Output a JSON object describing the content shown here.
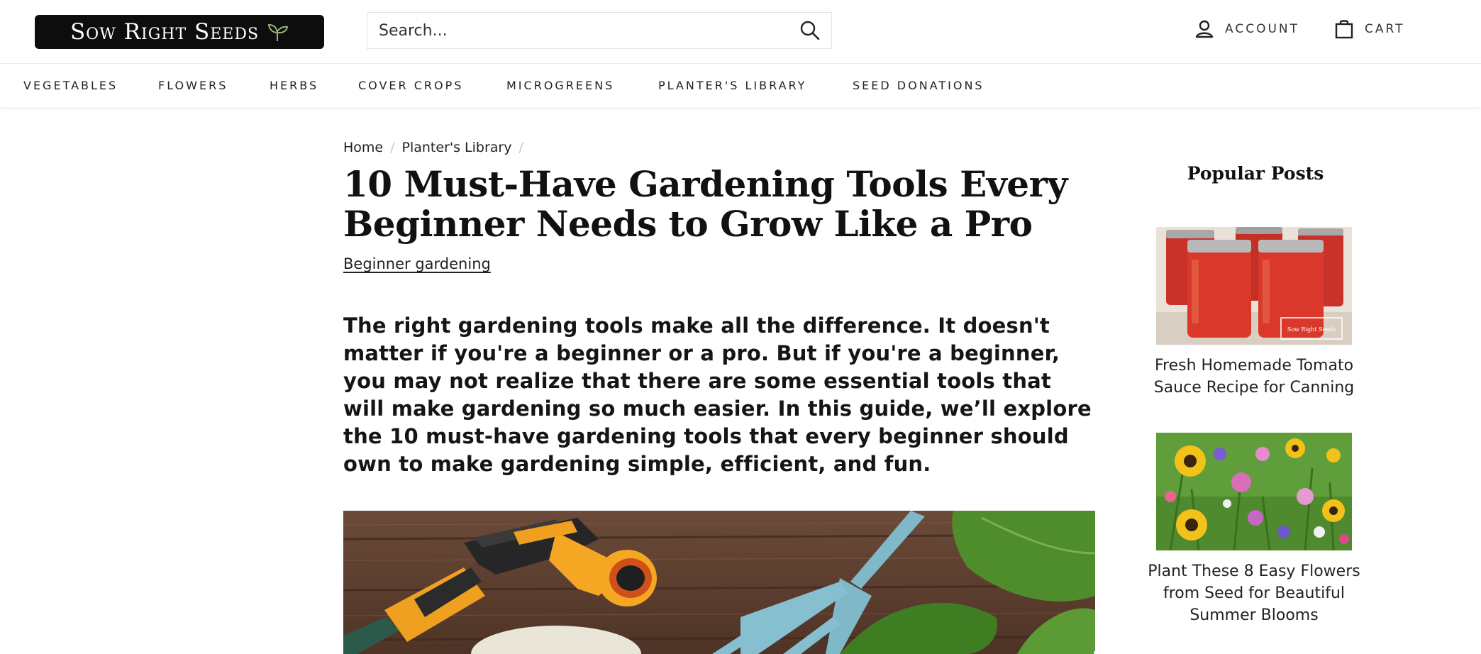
{
  "header": {
    "logo_text": "Sow Right Seeds",
    "search_placeholder": "Search...",
    "account_label": "ACCOUNT",
    "cart_label": "CART"
  },
  "nav": {
    "items": [
      "VEGETABLES",
      "FLOWERS",
      "HERBS",
      "COVER CROPS",
      "MICROGREENS",
      "PLANTER'S LIBRARY",
      "SEED DONATIONS"
    ]
  },
  "breadcrumb": {
    "home": "Home",
    "separator": "/",
    "current": "Planter's Library"
  },
  "article": {
    "title": "10 Must-Have Gardening Tools Every Beginner Needs to Grow Like a Pro",
    "tag": "Beginner gardening",
    "intro": "The right gardening tools make all the difference. It doesn't matter if you're a beginner or a pro. But if you're a beginner, you may not realize that there are some essential tools that will make gardening so much easier. In this guide, we’ll explore the 10 must-have gardening tools that every beginner should own to make gardening simple, efficient, and fun."
  },
  "sidebar": {
    "title": "Popular Posts",
    "posts": [
      {
        "title": "Fresh Homemade Tomato Sauce Recipe for Canning",
        "watermark": "Sow Right Seeds"
      },
      {
        "title": "Plant These 8 Easy Flowers from Seed for Beautiful Summer Blooms"
      }
    ]
  },
  "colors": {
    "logo_bg": "#0d0d0d",
    "text": "#1a1a1a",
    "nozzle_orange": "#f5a623",
    "fork_blue": "#7fb8c9",
    "sauce_red": "#d9382a"
  }
}
